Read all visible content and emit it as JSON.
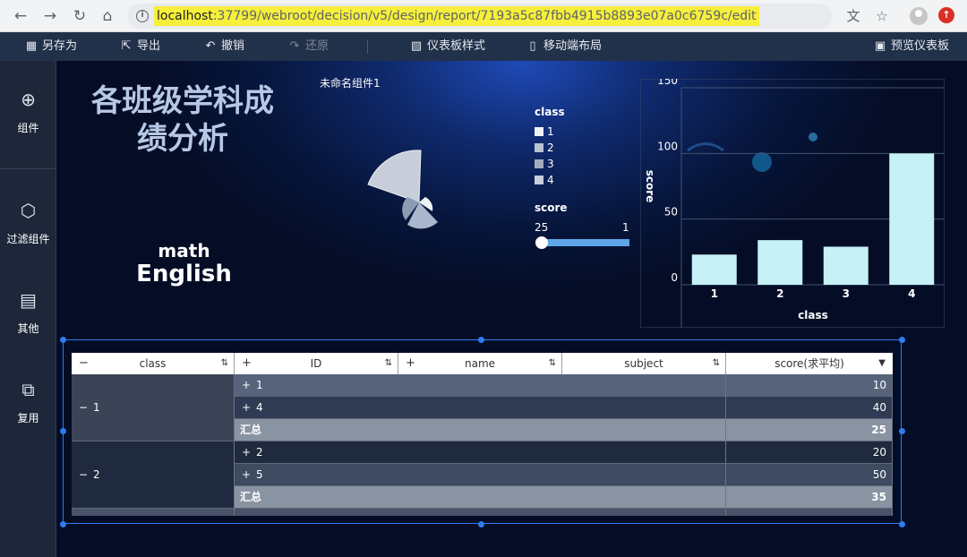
{
  "browser": {
    "url_host": "localhost",
    "url_path": ":37799/webroot/decision/v5/design/report/7193a5c87fbb4915b8893e07a0c6759c/edit"
  },
  "toolbar": {
    "save_as": "另存为",
    "export": "导出",
    "undo": "撤销",
    "redo": "还原",
    "dashboard_style": "仪表板样式",
    "mobile_layout": "移动端布局",
    "preview": "预览仪表板"
  },
  "rail": {
    "component": "组件",
    "filter_component": "过滤组件",
    "other": "其他",
    "reuse": "复用"
  },
  "canvas": {
    "title_line1": "各班级学科成",
    "title_line2": "绩分析",
    "word1": "math",
    "word2": "English",
    "widget_name": "未命名组件1"
  },
  "legend": {
    "title": "class",
    "items": [
      "1",
      "2",
      "3",
      "4"
    ],
    "colors": [
      "#eef3f8",
      "#b9c2d2",
      "#a3adbf",
      "#c9d0dc"
    ],
    "slider_title": "score",
    "slider_min": "25",
    "slider_max": "1"
  },
  "chart_data": {
    "type": "bar",
    "categories": [
      "1",
      "2",
      "3",
      "4"
    ],
    "values": [
      23,
      34,
      29,
      100
    ],
    "xlabel": "class",
    "ylabel": "score",
    "ylim": [
      0,
      150
    ],
    "yticks": [
      "0",
      "50",
      "100",
      "150"
    ],
    "grid": true,
    "color": "#c6f1f6"
  },
  "table": {
    "headers": {
      "class": "class",
      "id": "ID",
      "name": "name",
      "subject": "subject",
      "score": "score(求平均)"
    },
    "plus": "+",
    "minus": "−",
    "groups": [
      {
        "class": "1",
        "rows": [
          {
            "id": "1",
            "score": "10"
          },
          {
            "id": "4",
            "score": "40"
          }
        ],
        "total_label": "汇总",
        "total": "25"
      },
      {
        "class": "2",
        "rows": [
          {
            "id": "2",
            "score": "20"
          },
          {
            "id": "5",
            "score": "50"
          }
        ],
        "total_label": "汇总",
        "total": "35"
      }
    ]
  }
}
